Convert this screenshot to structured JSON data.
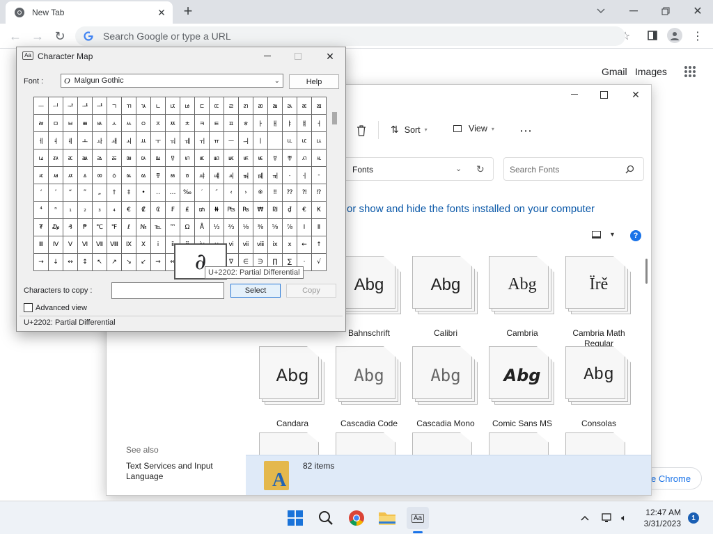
{
  "browser": {
    "tab_title": "New Tab",
    "omnibox_placeholder": "Search Google or type a URL",
    "links": {
      "gmail": "Gmail",
      "images": "Images"
    },
    "partial_text": "e Chrome"
  },
  "explorer": {
    "toolbar": {
      "sort": "Sort",
      "view": "View"
    },
    "address_crumb": "Fonts",
    "search_placeholder": "Search Fonts",
    "description": "or show and hide the fonts installed on your computer",
    "see_also": "See also",
    "text_services": "Text Services and Input Language",
    "status_count": "82 items",
    "fonts": [
      {
        "name": "Bahnschrift",
        "sample": "Abg"
      },
      {
        "name": "Calibri",
        "sample": "Abg"
      },
      {
        "name": "Cambria",
        "sample": "Abg"
      },
      {
        "name": "Cambria Math Regular",
        "sample": "Ïrě"
      },
      {
        "name": "Candara",
        "sample": "Abg"
      },
      {
        "name": "Cascadia Code",
        "sample": "Abg"
      },
      {
        "name": "Cascadia Mono",
        "sample": "Abg"
      },
      {
        "name": "Comic Sans MS",
        "sample": "Abg"
      },
      {
        "name": "Consolas",
        "sample": "Abg"
      }
    ]
  },
  "charmap": {
    "title": "Character Map",
    "font_label": "Font :",
    "font_value": "Malgun Gothic",
    "help": "Help",
    "rows": [
      [
        "ᅳ",
        "ᅴ",
        "ᅷ",
        "ᅸ",
        "ᅹ",
        "ㄱ",
        "ㄲ",
        "ㄳ",
        "ㄴ",
        "ㄵ",
        "ㄶ",
        "ㄷ",
        "ㄸ",
        "ㄹ",
        "ㄺ",
        "ㄻ",
        "ㄼ",
        "ㄽ",
        "ㄾ",
        "ㄿ"
      ],
      [
        "ㅀ",
        "ㅁ",
        "ㅂ",
        "ㅃ",
        "ㅄ",
        "ㅅ",
        "ㅆ",
        "ㅇ",
        "ㅈ",
        "ㅉ",
        "ㅊ",
        "ㅋ",
        "ㅌ",
        "ㅍ",
        "ㅎ",
        "ㅏ",
        "ㅐ",
        "ㅑ",
        "ㅒ",
        "ㅓ"
      ],
      [
        "ㅔ",
        "ㅕ",
        "ㅖ",
        "ㅗ",
        "ㅘ",
        "ㅙ",
        "ㅚ",
        "ㅛ",
        "ㅜ",
        "ㅝ",
        "ㅞ",
        "ㅟ",
        "ㅠ",
        "ㅡ",
        "ㅢ",
        "ㅣ",
        "ㅤ",
        "ㅥ",
        "ㅦ",
        "ㅧ"
      ],
      [
        "ㅨ",
        "ㅩ",
        "ㅪ",
        "ㅫ",
        "ㅬ",
        "ㅭ",
        "ㅮ",
        "ㅯ",
        "ㅰ",
        "ㅱ",
        "ㅲ",
        "ㅳ",
        "ㅴ",
        "ㅵ",
        "ㅶ",
        "ㅷ",
        "ㅸ",
        "ㅹ",
        "ㅺ",
        "ㅻ"
      ],
      [
        "ㅼ",
        "ㅽ",
        "ㅾ",
        "ㅿ",
        "ㆀ",
        "ㆁ",
        "ㆂ",
        "ㆃ",
        "ㆄ",
        "ㆅ",
        "ㆆ",
        "ㆇ",
        "ㆈ",
        "ㆉ",
        "ㆊ",
        "ㆋ",
        "ㆌ",
        "ㆍ",
        "ㆎ",
        "‐"
      ],
      [
        "‘",
        "’",
        "“",
        "”",
        "„",
        "†",
        "‡",
        "•",
        "‥",
        "…",
        "‰",
        "′",
        "″",
        "‹",
        "›",
        "※",
        "‼",
        "⁇",
        "⁈",
        "⁉"
      ],
      [
        "⁴",
        "ⁿ",
        "₁",
        "₂",
        "₃",
        "₄",
        "€",
        "₡",
        "₢",
        "₣",
        "₤",
        "₥",
        "₦",
        "₧",
        "₨",
        "₩",
        "₪",
        "₫",
        "€",
        "₭"
      ],
      [
        "₮",
        "₯",
        "₰",
        "₱",
        "℃",
        "℉",
        "ℓ",
        "№",
        "℡",
        "™",
        "Ω",
        "Å",
        "⅓",
        "⅔",
        "⅛",
        "⅜",
        "⅝",
        "⅞",
        "Ⅰ",
        "Ⅱ"
      ],
      [
        "Ⅲ",
        "Ⅳ",
        "Ⅴ",
        "Ⅵ",
        "Ⅶ",
        "Ⅷ",
        "Ⅸ",
        "Ⅹ",
        "ⅰ",
        "ⅱ",
        "ⅲ",
        "ⅳ",
        "ⅴ",
        "ⅵ",
        "ⅶ",
        "ⅷ",
        "ⅸ",
        "ⅹ",
        "←",
        "↑"
      ],
      [
        "→",
        "↓",
        "↔",
        "↕",
        "↖",
        "↗",
        "↘",
        "↙",
        "⇒",
        "⇔",
        "∀",
        "∂",
        "∃",
        "∇",
        "∈",
        "∋",
        "∏",
        "∑",
        "·",
        "√"
      ]
    ],
    "zoom_char": "∂",
    "tooltip": "U+2202: Partial Differential",
    "copy_label": "Characters to copy :",
    "copy_value": "",
    "select": "Select",
    "copy": "Copy",
    "advanced": "Advanced view",
    "status": "U+2202: Partial Differential"
  },
  "taskbar": {
    "time": "12:47 AM",
    "date": "3/31/2023",
    "badge": "1"
  }
}
